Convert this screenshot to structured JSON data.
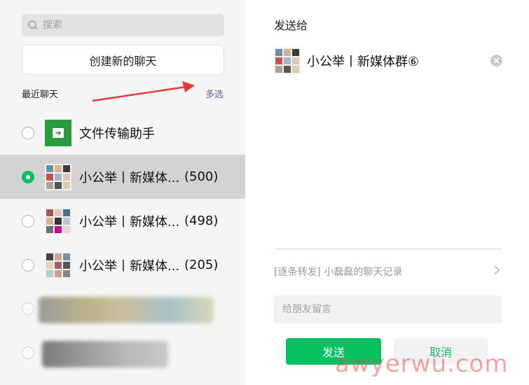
{
  "search": {
    "placeholder": "搜索"
  },
  "create_button": "创建新的聊天",
  "recent_label": "最近聊天",
  "multi_select": "多选",
  "chats": [
    {
      "name": "文件传输助手",
      "count": "",
      "selected": false,
      "icon": "file-transfer-icon"
    },
    {
      "name": "小公举丨新媒体...",
      "count": "(500)",
      "selected": true,
      "icon": "group-avatar"
    },
    {
      "name": "小公举丨新媒体...",
      "count": "(498)",
      "selected": false,
      "icon": "group-avatar"
    },
    {
      "name": "小公举丨新媒体...",
      "count": "(205)",
      "selected": false,
      "icon": "group-avatar"
    }
  ],
  "right": {
    "send_to_title": "发送给",
    "target_name": "小公举丨新媒体群⑥",
    "forward_note": "[逐条转发] 小磊磊的聊天记录",
    "message_placeholder": "给朋友留言",
    "send_label": "发送",
    "cancel_label": "取消"
  },
  "watermark": "awyerwu.com",
  "colors": {
    "accent": "#07c160",
    "link": "#576b95",
    "arrow": "#e53935",
    "file_icon_bg": "#2a9c3f",
    "watermark": "#e85a5a"
  }
}
